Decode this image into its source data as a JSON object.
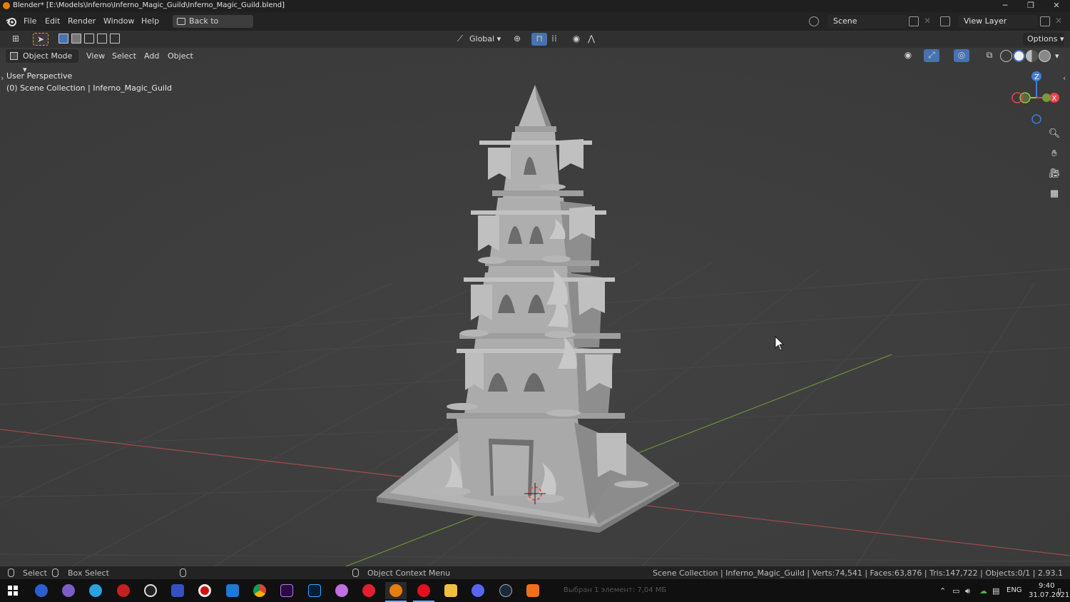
{
  "titlebar": {
    "title": "Blender* [E:\\Models\\Inferno\\Inferno_Magic_Guild\\Inferno_Magic_Guild.blend]",
    "minimize": "─",
    "maximize": "❐",
    "close": "✕"
  },
  "menubar": {
    "items": [
      "File",
      "Edit",
      "Render",
      "Window",
      "Help"
    ],
    "back_button": "Back to Previous",
    "scene": "Scene",
    "view_layer": "View Layer"
  },
  "editor_header": {
    "orientation": "Global",
    "options": "Options"
  },
  "viewport_header": {
    "mode": "Object Mode",
    "menus": [
      "View",
      "Select",
      "Add",
      "Object"
    ]
  },
  "viewport": {
    "perspective": "User Perspective",
    "collection_info": "(0) Scene Collection | Inferno_Magic_Guild",
    "gizmo": {
      "z": "Z",
      "x": "X",
      "y": "Y"
    }
  },
  "statusbar": {
    "select": "Select",
    "box_select": "Box Select",
    "context_menu": "Object Context Menu",
    "stats": "Scene Collection | Inferno_Magic_Guild | Verts:74,541 | Faces:63,876 | Tris:147,722 | Objects:0/1 | 2.93.1"
  },
  "taskbar": {
    "file_info": "Выбран 1 элемент: 7,04 МБ",
    "lang": "ENG",
    "time": "9:40",
    "date": "31.07.2021"
  },
  "colors": {
    "selection_blue": "#4772b3",
    "x_axis": "#e8434e",
    "y_axis": "#8bc34a",
    "z_axis": "#3d7fd8"
  }
}
